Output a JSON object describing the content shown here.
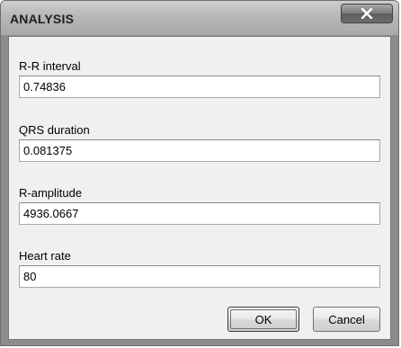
{
  "window": {
    "title": "ANALYSIS",
    "close_glyph": "x"
  },
  "fields": [
    {
      "label": "R-R interval",
      "value": "0.74836"
    },
    {
      "label": "QRS duration",
      "value": "0.081375"
    },
    {
      "label": "R-amplitude",
      "value": "4936.0667"
    },
    {
      "label": "Heart rate",
      "value": "80"
    }
  ],
  "buttons": {
    "ok_label": "OK",
    "cancel_label": "Cancel"
  },
  "icons": {
    "close": "close-icon"
  },
  "colors": {
    "titlebar": "#b7b7b7",
    "client_background": "#f0f0f0",
    "close_button": "#6d6d6d"
  }
}
